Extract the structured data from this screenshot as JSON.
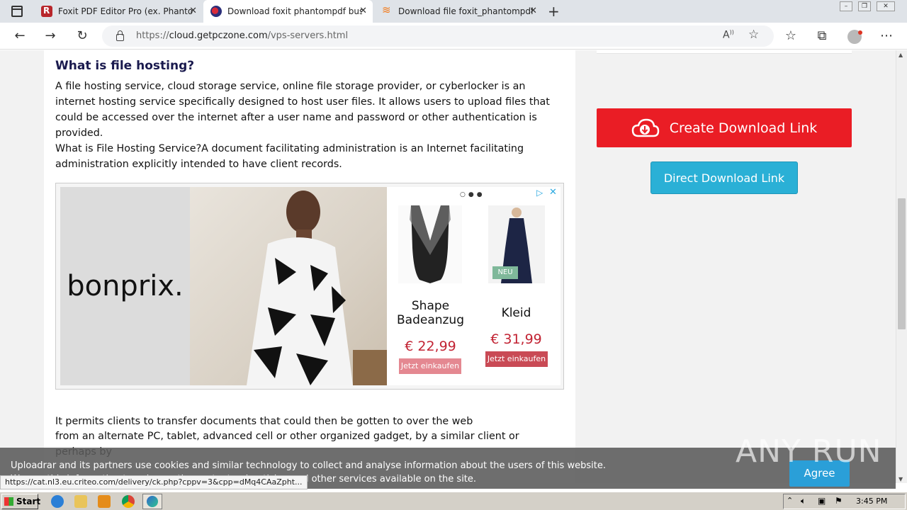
{
  "tabs": [
    {
      "title": "Foxit PDF Editor Pro (ex. Phantom",
      "favicon": "foxit-icon"
    },
    {
      "title": "Download foxit phantompdf busi",
      "favicon": "getpczone-icon"
    },
    {
      "title": "Download file foxit_phantompdf_",
      "favicon": "uploadrar-icon"
    }
  ],
  "address": {
    "prefix": "https://",
    "host": "cloud.getpczone.com",
    "path": "/vps-servers.html"
  },
  "article": {
    "heading": "What is file hosting?",
    "para1": "A file hosting service, cloud storage service, online file storage provider, or cyberlocker is an internet hosting service specifically designed to host user files. It allows users to upload files that could be accessed over the internet after a user name and password or other authentication is provided.",
    "para2": "What is File Hosting Service?A document facilitating administration is an Internet facilitating administration explicitly intended to have client records.",
    "para3": "It permits clients to transfer documents that could then be gotten to over the web",
    "para4": "from an alternate PC, tablet, advanced cell or other organized gadget, by a similar client or perhaps by"
  },
  "ad": {
    "brand": "bonprix.",
    "products": [
      {
        "name": "Shape Badeanzug",
        "price": "€ 22,99",
        "button": "Jetzt einkaufen"
      },
      {
        "name": "Kleid",
        "price": "€ 31,99",
        "button": "Jetzt einkaufen",
        "badge": "NEU"
      }
    ]
  },
  "sidebar": {
    "create_label": "Create Download Link",
    "direct_label": "Direct Download Link"
  },
  "cookie": {
    "text": "Uploadrar and its partners use cookies and similar technology to collect and analyse information about the users of this website. We use this information to enhance the content, advertising and other services available on the site.",
    "agree": "Agree"
  },
  "status_url": "https://cat.nl3.eu.criteo.com/delivery/ck.php?cppv=3&cpp=dMq4CAaZpht...",
  "watermark": "ANY RUN",
  "taskbar": {
    "start": "Start",
    "time": "3:45 PM"
  },
  "colors": {
    "accent_red": "#ea1d25",
    "accent_blue": "#2ab0d6",
    "price_red": "#c22333"
  }
}
